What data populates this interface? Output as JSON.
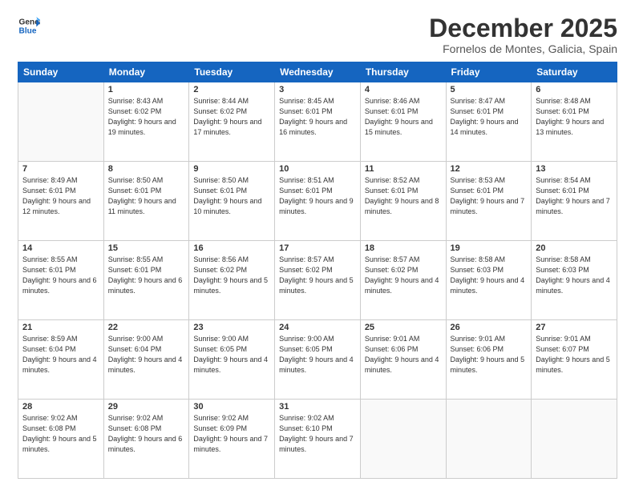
{
  "logo": {
    "line1": "General",
    "line2": "Blue"
  },
  "header": {
    "month": "December 2025",
    "location": "Fornelos de Montes, Galicia, Spain"
  },
  "weekdays": [
    "Sunday",
    "Monday",
    "Tuesday",
    "Wednesday",
    "Thursday",
    "Friday",
    "Saturday"
  ],
  "weeks": [
    [
      {
        "num": "",
        "empty": true
      },
      {
        "num": "1",
        "sunrise": "Sunrise: 8:43 AM",
        "sunset": "Sunset: 6:02 PM",
        "daylight": "Daylight: 9 hours and 19 minutes."
      },
      {
        "num": "2",
        "sunrise": "Sunrise: 8:44 AM",
        "sunset": "Sunset: 6:02 PM",
        "daylight": "Daylight: 9 hours and 17 minutes."
      },
      {
        "num": "3",
        "sunrise": "Sunrise: 8:45 AM",
        "sunset": "Sunset: 6:01 PM",
        "daylight": "Daylight: 9 hours and 16 minutes."
      },
      {
        "num": "4",
        "sunrise": "Sunrise: 8:46 AM",
        "sunset": "Sunset: 6:01 PM",
        "daylight": "Daylight: 9 hours and 15 minutes."
      },
      {
        "num": "5",
        "sunrise": "Sunrise: 8:47 AM",
        "sunset": "Sunset: 6:01 PM",
        "daylight": "Daylight: 9 hours and 14 minutes."
      },
      {
        "num": "6",
        "sunrise": "Sunrise: 8:48 AM",
        "sunset": "Sunset: 6:01 PM",
        "daylight": "Daylight: 9 hours and 13 minutes."
      }
    ],
    [
      {
        "num": "7",
        "sunrise": "Sunrise: 8:49 AM",
        "sunset": "Sunset: 6:01 PM",
        "daylight": "Daylight: 9 hours and 12 minutes."
      },
      {
        "num": "8",
        "sunrise": "Sunrise: 8:50 AM",
        "sunset": "Sunset: 6:01 PM",
        "daylight": "Daylight: 9 hours and 11 minutes."
      },
      {
        "num": "9",
        "sunrise": "Sunrise: 8:50 AM",
        "sunset": "Sunset: 6:01 PM",
        "daylight": "Daylight: 9 hours and 10 minutes."
      },
      {
        "num": "10",
        "sunrise": "Sunrise: 8:51 AM",
        "sunset": "Sunset: 6:01 PM",
        "daylight": "Daylight: 9 hours and 9 minutes."
      },
      {
        "num": "11",
        "sunrise": "Sunrise: 8:52 AM",
        "sunset": "Sunset: 6:01 PM",
        "daylight": "Daylight: 9 hours and 8 minutes."
      },
      {
        "num": "12",
        "sunrise": "Sunrise: 8:53 AM",
        "sunset": "Sunset: 6:01 PM",
        "daylight": "Daylight: 9 hours and 7 minutes."
      },
      {
        "num": "13",
        "sunrise": "Sunrise: 8:54 AM",
        "sunset": "Sunset: 6:01 PM",
        "daylight": "Daylight: 9 hours and 7 minutes."
      }
    ],
    [
      {
        "num": "14",
        "sunrise": "Sunrise: 8:55 AM",
        "sunset": "Sunset: 6:01 PM",
        "daylight": "Daylight: 9 hours and 6 minutes."
      },
      {
        "num": "15",
        "sunrise": "Sunrise: 8:55 AM",
        "sunset": "Sunset: 6:01 PM",
        "daylight": "Daylight: 9 hours and 6 minutes."
      },
      {
        "num": "16",
        "sunrise": "Sunrise: 8:56 AM",
        "sunset": "Sunset: 6:02 PM",
        "daylight": "Daylight: 9 hours and 5 minutes."
      },
      {
        "num": "17",
        "sunrise": "Sunrise: 8:57 AM",
        "sunset": "Sunset: 6:02 PM",
        "daylight": "Daylight: 9 hours and 5 minutes."
      },
      {
        "num": "18",
        "sunrise": "Sunrise: 8:57 AM",
        "sunset": "Sunset: 6:02 PM",
        "daylight": "Daylight: 9 hours and 4 minutes."
      },
      {
        "num": "19",
        "sunrise": "Sunrise: 8:58 AM",
        "sunset": "Sunset: 6:03 PM",
        "daylight": "Daylight: 9 hours and 4 minutes."
      },
      {
        "num": "20",
        "sunrise": "Sunrise: 8:58 AM",
        "sunset": "Sunset: 6:03 PM",
        "daylight": "Daylight: 9 hours and 4 minutes."
      }
    ],
    [
      {
        "num": "21",
        "sunrise": "Sunrise: 8:59 AM",
        "sunset": "Sunset: 6:04 PM",
        "daylight": "Daylight: 9 hours and 4 minutes."
      },
      {
        "num": "22",
        "sunrise": "Sunrise: 9:00 AM",
        "sunset": "Sunset: 6:04 PM",
        "daylight": "Daylight: 9 hours and 4 minutes."
      },
      {
        "num": "23",
        "sunrise": "Sunrise: 9:00 AM",
        "sunset": "Sunset: 6:05 PM",
        "daylight": "Daylight: 9 hours and 4 minutes."
      },
      {
        "num": "24",
        "sunrise": "Sunrise: 9:00 AM",
        "sunset": "Sunset: 6:05 PM",
        "daylight": "Daylight: 9 hours and 4 minutes."
      },
      {
        "num": "25",
        "sunrise": "Sunrise: 9:01 AM",
        "sunset": "Sunset: 6:06 PM",
        "daylight": "Daylight: 9 hours and 4 minutes."
      },
      {
        "num": "26",
        "sunrise": "Sunrise: 9:01 AM",
        "sunset": "Sunset: 6:06 PM",
        "daylight": "Daylight: 9 hours and 5 minutes."
      },
      {
        "num": "27",
        "sunrise": "Sunrise: 9:01 AM",
        "sunset": "Sunset: 6:07 PM",
        "daylight": "Daylight: 9 hours and 5 minutes."
      }
    ],
    [
      {
        "num": "28",
        "sunrise": "Sunrise: 9:02 AM",
        "sunset": "Sunset: 6:08 PM",
        "daylight": "Daylight: 9 hours and 5 minutes."
      },
      {
        "num": "29",
        "sunrise": "Sunrise: 9:02 AM",
        "sunset": "Sunset: 6:08 PM",
        "daylight": "Daylight: 9 hours and 6 minutes."
      },
      {
        "num": "30",
        "sunrise": "Sunrise: 9:02 AM",
        "sunset": "Sunset: 6:09 PM",
        "daylight": "Daylight: 9 hours and 7 minutes."
      },
      {
        "num": "31",
        "sunrise": "Sunrise: 9:02 AM",
        "sunset": "Sunset: 6:10 PM",
        "daylight": "Daylight: 9 hours and 7 minutes."
      },
      {
        "num": "",
        "empty": true
      },
      {
        "num": "",
        "empty": true
      },
      {
        "num": "",
        "empty": true
      }
    ]
  ]
}
